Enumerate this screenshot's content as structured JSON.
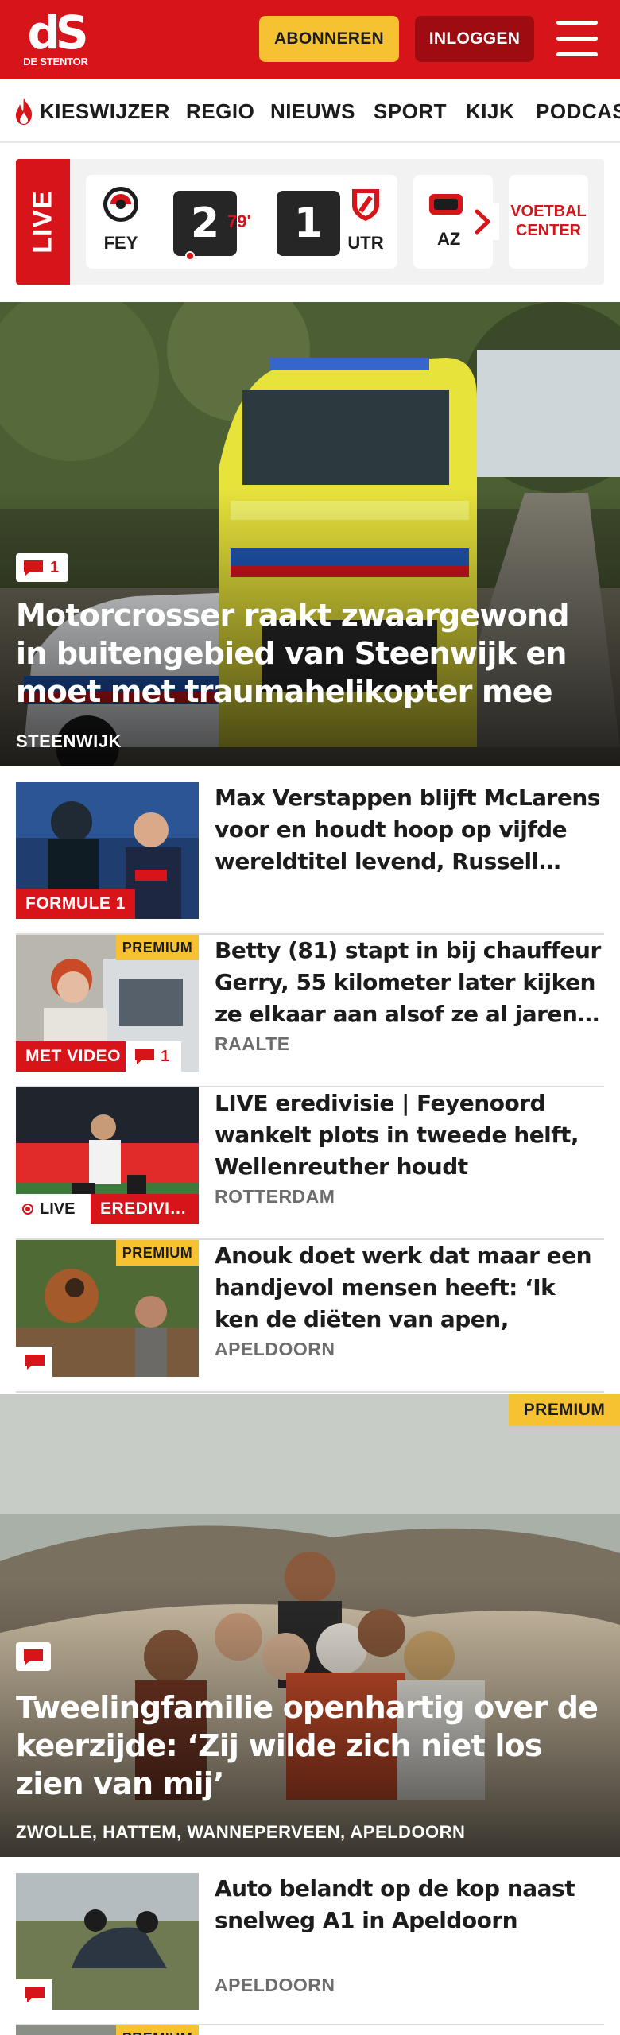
{
  "header": {
    "logo_mark": "dS",
    "logo_name": "DE STENTOR",
    "subscribe_label": "ABONNEREN",
    "login_label": "INLOGGEN",
    "brand_color": "#d8141b",
    "menu_icon": "hamburger-menu-icon"
  },
  "nav": {
    "items": [
      "KIESWIJZER",
      "REGIO",
      "NIEUWS",
      "SPORT",
      "KIJK",
      "PODCAS"
    ],
    "first_icon": "flame-icon"
  },
  "live": {
    "label": "LIVE",
    "match": {
      "home": "FEY",
      "away": "UTR",
      "home_score": "2",
      "away_score": "1",
      "minute": "79'"
    },
    "next_match_code": "AZ",
    "center_label": "VOETBAL CENTER"
  },
  "hero1": {
    "comments": "1",
    "title": "Motorcrosser raakt zwaargewond in buitengebied van Steenwijk en moet met traumahelikopter mee",
    "location": "STEENWIJK"
  },
  "articles": [
    {
      "title": "Max Verstappen blijft McLarens voor en houdt hoop op vijfde wereldtitel levend, Russell…",
      "category": "FORMULE 1",
      "location": ""
    },
    {
      "title": "Betty (81) stapt in bij chauffeur Gerry, 55 kilometer later kijken ze elkaar aan alsof ze al jaren…",
      "premium": "PREMIUM",
      "category": "MET VIDEO",
      "comments": "1",
      "location": "RAALTE"
    },
    {
      "title": "LIVE eredivisie | Feyenoord wankelt plots in tweede helft, Wellenreuther houdt voorspron…",
      "live_label": "LIVE",
      "category": "EREDIVI…",
      "location": "ROTTERDAM"
    },
    {
      "title": "Anouk doet werk dat maar een handjevol mensen heeft: ‘Ik ken de diëten van apen, zeepaardje…",
      "premium": "PREMIUM",
      "location": "APELDOORN"
    }
  ],
  "hero2": {
    "premium": "PREMIUM",
    "title": "Tweelingfamilie openhartig over de keerzijde: ‘Zij wilde zich niet los zien van mij’",
    "location": "ZWOLLE, HATTEM, WANNEPERVEEN, APELDOORN"
  },
  "article6": {
    "title": "Auto belandt op de kop naast snelweg A1 in Apeldoorn",
    "location": "APELDOORN"
  },
  "article7": {
    "premium": "PREMIUM"
  }
}
